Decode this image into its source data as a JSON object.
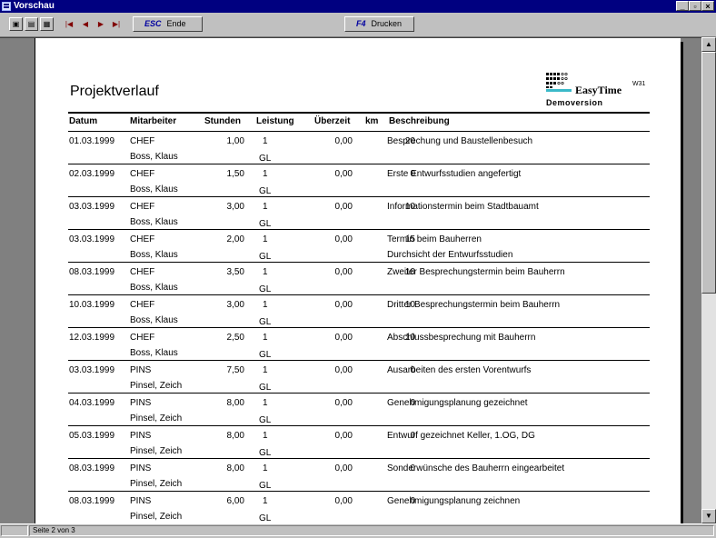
{
  "window": {
    "title": "Vorschau"
  },
  "toolbar": {
    "esc_key": "ESC",
    "esc_label": "Ende",
    "print_key": "F4",
    "print_label": "Drucken"
  },
  "report": {
    "title": "Projektverlauf",
    "logo": {
      "name": "EasyTime",
      "version": "W31",
      "subtitle": "Demoversion"
    },
    "columns": [
      "Datum",
      "Mitarbeiter",
      "Stunden",
      "Leistung",
      "Überzeit",
      "km",
      "Beschreibung"
    ],
    "rows": [
      {
        "date": "01.03.1999",
        "emp": "CHEF",
        "emp_name": "Boss, Klaus",
        "hours": "1,00",
        "perf": "1",
        "perf2": "GL",
        "overtime": "0,00",
        "km": "20",
        "desc": "Besprechung und Baustellenbesuch",
        "desc2": ""
      },
      {
        "date": "02.03.1999",
        "emp": "CHEF",
        "emp_name": "Boss, Klaus",
        "hours": "1,50",
        "perf": "1",
        "perf2": "GL",
        "overtime": "0,00",
        "km": "0",
        "desc": "Erste Entwurfsstudien angefertigt",
        "desc2": ""
      },
      {
        "date": "03.03.1999",
        "emp": "CHEF",
        "emp_name": "Boss, Klaus",
        "hours": "3,00",
        "perf": "1",
        "perf2": "GL",
        "overtime": "0,00",
        "km": "10",
        "desc": "Informationstermin beim Stadtbauamt",
        "desc2": ""
      },
      {
        "date": "03.03.1999",
        "emp": "CHEF",
        "emp_name": "Boss, Klaus",
        "hours": "2,00",
        "perf": "1",
        "perf2": "GL",
        "overtime": "0,00",
        "km": "15",
        "desc": "Termin beim Bauherren",
        "desc2": "Durchsicht der Entwurfsstudien"
      },
      {
        "date": "08.03.1999",
        "emp": "CHEF",
        "emp_name": "Boss, Klaus",
        "hours": "3,50",
        "perf": "1",
        "perf2": "GL",
        "overtime": "0,00",
        "km": "10",
        "desc": "Zweiter Besprechungstermin beim Bauherrn",
        "desc2": ""
      },
      {
        "date": "10.03.1999",
        "emp": "CHEF",
        "emp_name": "Boss, Klaus",
        "hours": "3,00",
        "perf": "1",
        "perf2": "GL",
        "overtime": "0,00",
        "km": "10",
        "desc": "Dritter Besprechungstermin beim Bauherrn",
        "desc2": ""
      },
      {
        "date": "12.03.1999",
        "emp": "CHEF",
        "emp_name": "Boss, Klaus",
        "hours": "2,50",
        "perf": "1",
        "perf2": "GL",
        "overtime": "0,00",
        "km": "10",
        "desc": "Abschlussbesprechung mit Bauherrn",
        "desc2": ""
      },
      {
        "date": "03.03.1999",
        "emp": "PINS",
        "emp_name": "Pinsel, Zeich",
        "hours": "7,50",
        "perf": "1",
        "perf2": "GL",
        "overtime": "0,00",
        "km": "0",
        "desc": "Ausarbeiten des ersten Vorentwurfs",
        "desc2": ""
      },
      {
        "date": "04.03.1999",
        "emp": "PINS",
        "emp_name": "Pinsel, Zeich",
        "hours": "8,00",
        "perf": "1",
        "perf2": "GL",
        "overtime": "0,00",
        "km": "0",
        "desc": "Genehmigungsplanung gezeichnet",
        "desc2": ""
      },
      {
        "date": "05.03.1999",
        "emp": "PINS",
        "emp_name": "Pinsel, Zeich",
        "hours": "8,00",
        "perf": "1",
        "perf2": "GL",
        "overtime": "0,00",
        "km": "0",
        "desc": "Entwurf gezeichnet Keller, 1.OG, DG",
        "desc2": ""
      },
      {
        "date": "08.03.1999",
        "emp": "PINS",
        "emp_name": "Pinsel, Zeich",
        "hours": "8,00",
        "perf": "1",
        "perf2": "GL",
        "overtime": "0,00",
        "km": "0",
        "desc": "Sonderwünsche des Bauherrn eingearbeitet",
        "desc2": ""
      },
      {
        "date": "08.03.1999",
        "emp": "PINS",
        "emp_name": "Pinsel, Zeich",
        "hours": "6,00",
        "perf": "1",
        "perf2": "GL",
        "overtime": "0,00",
        "km": "0",
        "desc": "Genehmigungsplanung zeichnen",
        "desc2": ""
      }
    ]
  },
  "status": {
    "page": "Seite 2 von 3"
  },
  "colors": {
    "titlebar": "#000080",
    "accent": "#3bb9c9"
  },
  "icons": [
    "app-icon",
    "single-page-icon",
    "two-page-icon",
    "zoom-icon",
    "first-page-icon",
    "prev-page-icon",
    "next-page-icon",
    "last-page-icon"
  ]
}
